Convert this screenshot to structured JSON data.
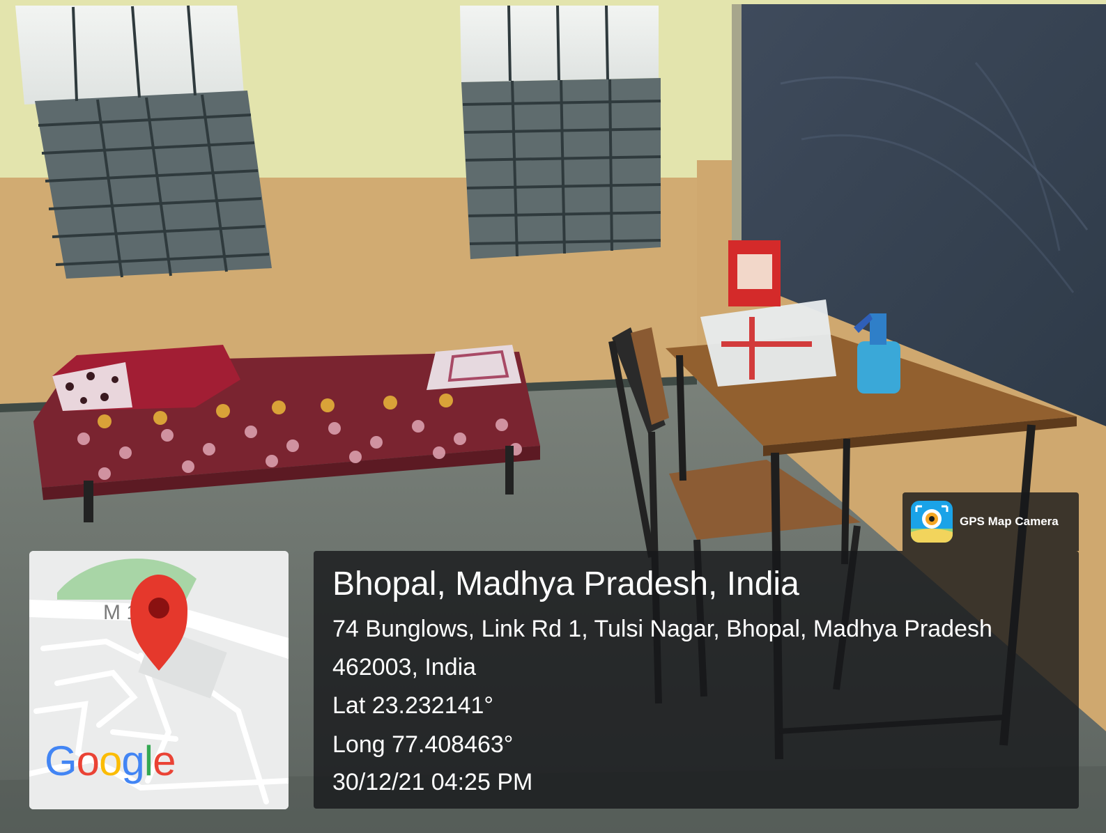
{
  "photo": {
    "description_icons": [
      "window-icon",
      "bed-icon",
      "table-icon",
      "chair-icon",
      "first-aid-box-icon",
      "spray-bottle-icon"
    ]
  },
  "map": {
    "road_label": "M   1",
    "logo_text": "Google"
  },
  "overlay": {
    "title": "Bhopal, Madhya Pradesh, India",
    "address_line1": "74 Bunglows, Link Rd 1, Tulsi Nagar, Bhopal, Madhya Pradesh",
    "address_line2": "462003, India",
    "latitude": "Lat 23.232141°",
    "longitude": "Long 77.408463°",
    "timestamp": "30/12/21 04:25 PM"
  },
  "brand": {
    "label": "GPS Map Camera"
  },
  "colors": {
    "wall_upper": "#e6e6b0",
    "wall_lower": "#d2ad74",
    "floor": "#6e7670",
    "blackboard": "#3a4656",
    "bedsheet": "#7a2430",
    "pin": "#e5382c"
  }
}
